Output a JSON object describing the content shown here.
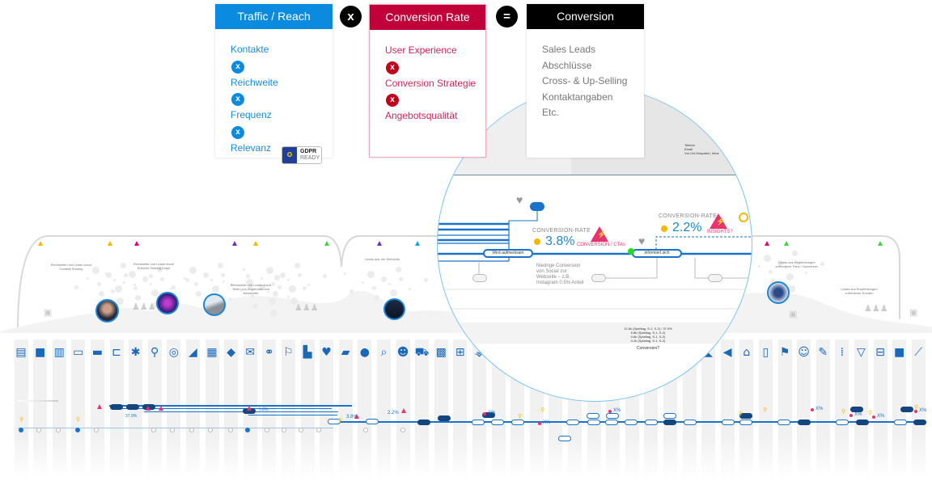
{
  "formula": {
    "traffic": {
      "title": "Traffic / Reach",
      "color": "#0a8be0",
      "items": [
        "Kontakte",
        "Reichweite",
        "Frequenz",
        "Relevanz"
      ],
      "operator": "x"
    },
    "times_operator": "x",
    "conversion_rate": {
      "title": "Conversion Rate",
      "color": "#c1003a",
      "items": [
        "User Experience",
        "Conversion Strategie",
        "Angebotsqualität"
      ],
      "operator": "x"
    },
    "equals_operator": "=",
    "conversion": {
      "title": "Conversion",
      "color": "#000000",
      "items": [
        "Sales Leads",
        "Abschlüsse",
        "Cross- & Up-Selling",
        "Kontaktangaben",
        "Etc."
      ]
    },
    "gdpr_badge": {
      "title": "GDPR",
      "subtitle": "READY"
    }
  },
  "landscape": {
    "captions": [
      "Reichweite und Leads durch Content Sharing",
      "Reichweite und Leads durch Erlebnis Sharing Event",
      "Reichweite und Leads durch Teilen von Angeboten und Newsletter",
      "Leads aus der Webseite",
      "Leads aus Empfehlungen zufriedener Fans / Sponsoren",
      "Leads aus Empfehlungen zufriedener Kunden"
    ],
    "marker_colors": [
      "#f5b800",
      "#f5b800",
      "#e8006e",
      "#7a2fa8",
      "#f5b800",
      "#3fd43f",
      "#7a2fa8",
      "#1aa3e0",
      "#e8006e",
      "#3fd43f",
      "#3fd43f"
    ]
  },
  "magnifier": {
    "stage_1": "Wird aufmerksam",
    "stage_2": "informiert sich",
    "conversion_rate_label": "CONVERSION-RATE",
    "rate_1": "3.8%",
    "alert_1": "CONVERSION / CTAs",
    "note": "Niedrige Conversion von Social zur Webseite – z.B. Instagram 0.5% Anteil",
    "rate_2": "2.2%",
    "alert_2": "INSIGHTS?",
    "question": "Conversion?",
    "stats": [
      "12.6k (Spieltag, S-1, S-2) / 37.9%",
      "5.8k (Spieltag, S-1, S-2)",
      "0.6k (Spieltag, S-1, S-2)",
      "0.2k (Spieltag, S-1, S-2)"
    ],
    "top_notes": [
      "Telefon",
      "Email",
      "Vor-Ort-Gespräch, Infos"
    ]
  },
  "timeline": {
    "accent": "#1a73c9",
    "dark": "#13457f",
    "rates": [
      "37.9%",
      "3.8%",
      "2.2%",
      "5.0%"
    ],
    "placeholder_pct": "X%",
    "icons": [
      "radio",
      "billboard",
      "magazine",
      "tv",
      "bus",
      "laptop",
      "network",
      "map-pin",
      "drum",
      "megaphone",
      "store",
      "tag",
      "newsletter",
      "handshake",
      "runner",
      "cash-register",
      "heart",
      "chat",
      "balloons",
      "search",
      "support-agent",
      "cart",
      "shop",
      "basket",
      "antenna",
      "",
      "",
      "",
      "",
      "",
      "",
      "",
      "",
      "",
      "",
      "",
      "ship",
      "speaker",
      "presentation",
      "shopping-bag",
      "hockey-player",
      "masks",
      "pen",
      "footsteps",
      "wine-glass",
      "train",
      "message",
      "chart"
    ]
  }
}
